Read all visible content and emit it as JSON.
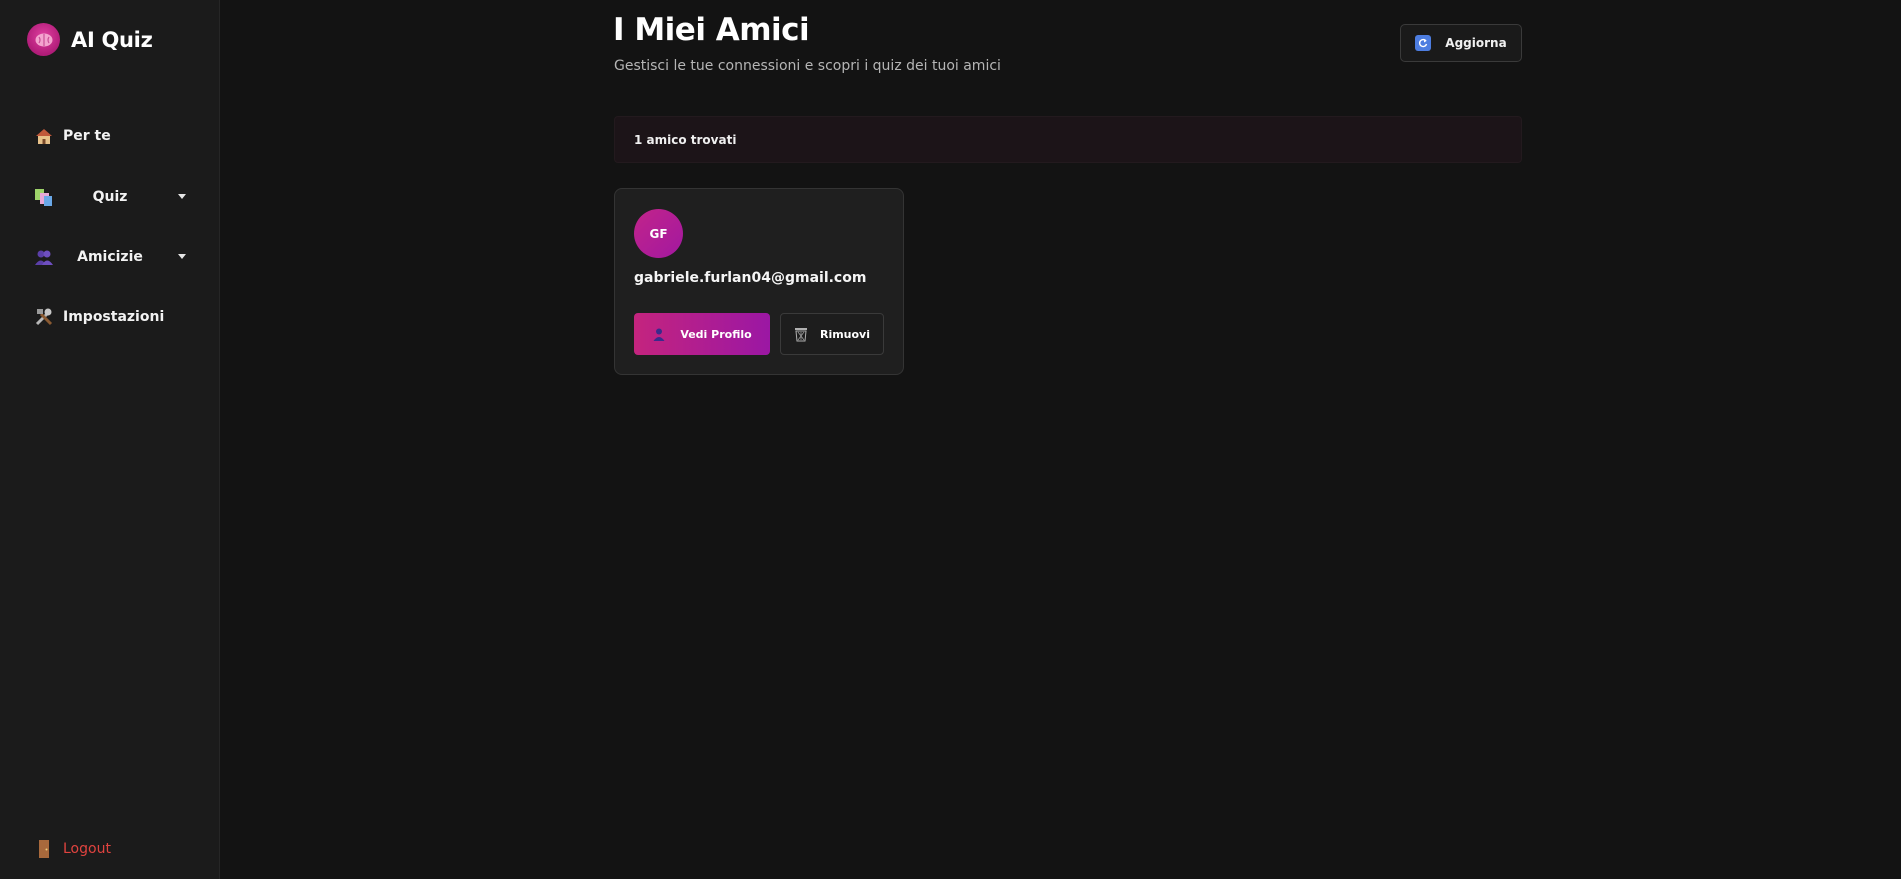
{
  "app": {
    "title": "AI Quiz"
  },
  "sidebar": {
    "items": [
      {
        "label": "Per te",
        "icon": "house-icon"
      },
      {
        "label": "Quiz",
        "icon": "books-icon",
        "expandable": true
      },
      {
        "label": "Amicizie",
        "icon": "people-icon",
        "expandable": true
      },
      {
        "label": "Impostazioni",
        "icon": "tools-icon"
      }
    ],
    "logout": {
      "label": "Logout",
      "icon": "door-icon"
    }
  },
  "header": {
    "title": "I Miei Amici",
    "subtitle": "Gestisci le tue connessioni e scopri i quiz dei tuoi amici",
    "refresh_label": "Aggiorna"
  },
  "friends": {
    "count_label": "1 amico trovati",
    "list": [
      {
        "initials": "GF",
        "email": "gabriele.furlan04@gmail.com",
        "view_label": "Vedi Profilo",
        "remove_label": "Rimuovi"
      }
    ]
  },
  "colors": {
    "background": "#131313",
    "sidebar": "#1b1b1b",
    "accent": "#c4247e",
    "accent_end": "#9b17a4",
    "logout": "#e0433f"
  }
}
